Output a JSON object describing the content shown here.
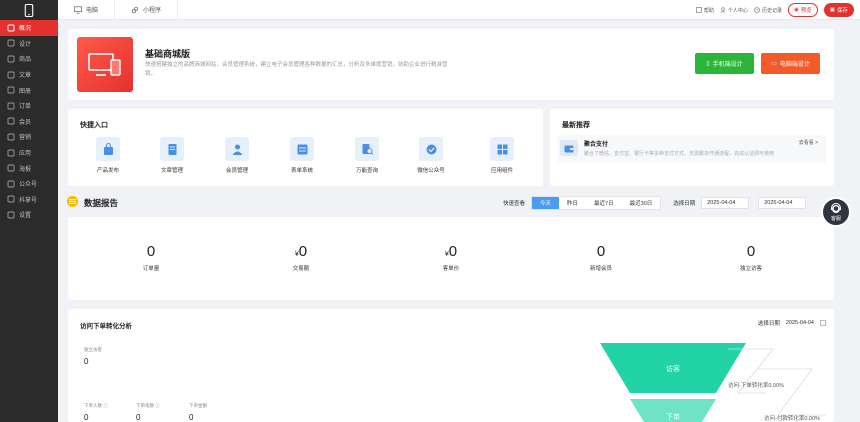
{
  "sidebar": {
    "items": [
      {
        "label": "概况",
        "icon": "dashboard-icon",
        "active": true
      },
      {
        "label": "设计",
        "icon": "design-icon"
      },
      {
        "label": "商品",
        "icon": "goods-icon"
      },
      {
        "label": "文章",
        "icon": "article-icon"
      },
      {
        "label": "图册",
        "icon": "album-icon"
      },
      {
        "label": "订单",
        "icon": "order-icon"
      },
      {
        "label": "会员",
        "icon": "member-icon"
      },
      {
        "label": "营销",
        "icon": "marketing-icon"
      },
      {
        "label": "应用",
        "icon": "app-icon"
      },
      {
        "label": "海报",
        "icon": "poster-icon"
      },
      {
        "label": "公众号",
        "icon": "wechat-icon"
      },
      {
        "label": "抖掌号",
        "icon": "douyin-icon"
      },
      {
        "label": "设置",
        "icon": "settings-icon"
      }
    ]
  },
  "topbar": {
    "tabs": [
      {
        "label": "电脑",
        "icon": "monitor-icon"
      },
      {
        "label": "小程序",
        "icon": "miniprogram-icon"
      }
    ],
    "links": {
      "help": "帮助",
      "personal": "个人中心",
      "history": "历史记录"
    },
    "preview": "预览",
    "save": "保存"
  },
  "hero": {
    "title": "基础商城版",
    "desc": "快速搭建独立的品牌商城网站、会员管理系统，建立电子会员管理各种数据的汇总，分析及多维度营销，协助企业进行精准营销。",
    "btn_mobile": "手机端设计",
    "btn_pc": "电脑端设计"
  },
  "quick": {
    "title": "快捷入口",
    "items": [
      {
        "label": "产品发布",
        "icon": "bag-icon"
      },
      {
        "label": "文章管理",
        "icon": "document-icon"
      },
      {
        "label": "会员管理",
        "icon": "user-icon"
      },
      {
        "label": "表单系统",
        "icon": "form-icon"
      },
      {
        "label": "万能查询",
        "icon": "search-doc-icon"
      },
      {
        "label": "微信公众号",
        "icon": "verified-icon"
      },
      {
        "label": "应用组件",
        "icon": "grid-icon"
      }
    ]
  },
  "recommend": {
    "title": "最新推荐",
    "item_title": "聚合支付",
    "item_desc": "聚合了微信、支付宝、银行卡等多种支付方式，无需繁杂开通流程，完成认证即可使用",
    "more": "去看看 >"
  },
  "report": {
    "title": "数据报告",
    "quick_label": "快速查看",
    "ranges": [
      "今天",
      "昨日",
      "最近7日",
      "最近30日"
    ],
    "active_range": 0,
    "date_label": "选择日期",
    "date_from": "2025-04-04",
    "date_to": "2025-04-04"
  },
  "stats": [
    {
      "value": "0",
      "label": "订单量",
      "currency": ""
    },
    {
      "value": "0",
      "label": "交易额",
      "currency": "¥"
    },
    {
      "value": "0",
      "label": "客单价",
      "currency": "¥"
    },
    {
      "value": "0",
      "label": "新增会员",
      "currency": ""
    },
    {
      "value": "0",
      "label": "独立访客",
      "currency": ""
    }
  ],
  "funnel": {
    "title": "访问下单转化分析",
    "date_label": "选择日期",
    "date": "2025-04-04",
    "uv_label": "独立访客",
    "uv_value": "0",
    "m1_label": "下单人数",
    "m1_value": "0",
    "m2_label": "下单笔数",
    "m2_value": "0",
    "m3_label": "下单金额",
    "m3_value": "0",
    "stage1": "访客",
    "stage2": "下单",
    "rate1": "访问-下单转化率0.00%",
    "rate2": "访问-付款转化率0.00%"
  },
  "kefu": "客服",
  "colors": {
    "brand": "#e4312e",
    "sidebar": "#2b2b2b",
    "green": "#2bb63a",
    "orange": "#f25b27",
    "funnel": "#22d3a6"
  }
}
